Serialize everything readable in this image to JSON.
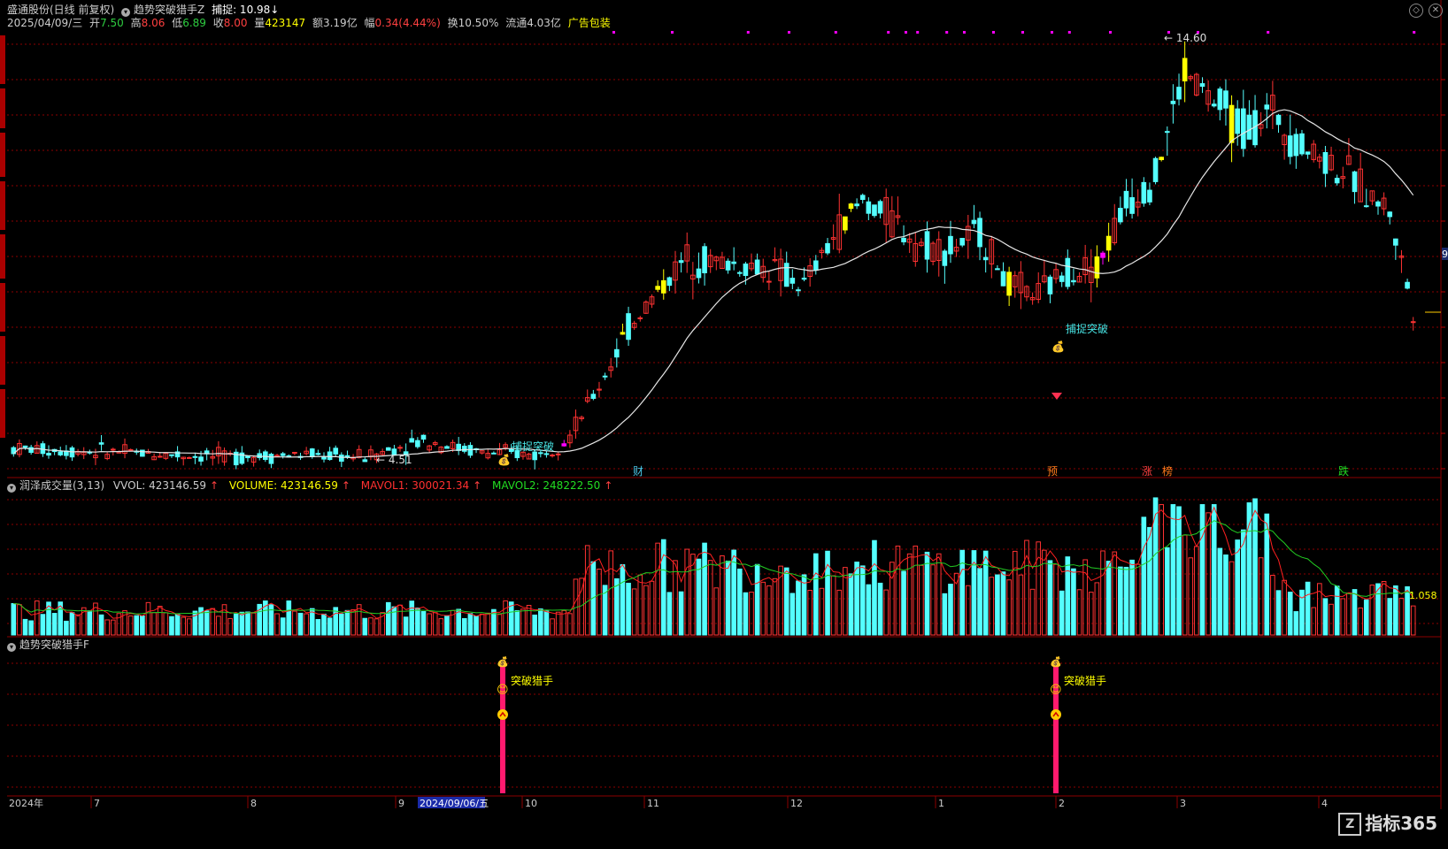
{
  "header": {
    "stock": "盛通股份(日线 前复权)",
    "indicator": "趋势突破猎手Z",
    "capture_label": "捕捉: 10.98",
    "capture_arrow": "↓",
    "date": "2025/04/09/三",
    "open_label": "开",
    "open": "7.50",
    "high_label": "高",
    "high": "8.06",
    "low_label": "低",
    "low": "6.89",
    "close_label": "收",
    "close": "8.00",
    "vol_label": "量",
    "vol": "423147",
    "amt_label": "额",
    "amt": "3.19亿",
    "chg_label": "幅",
    "chg": "0.34(4.44%)",
    "turn_label": "换",
    "turn": "10.50%",
    "float_label": "流通",
    "float": "4.03亿",
    "ad": "广告包装"
  },
  "price_labels": {
    "high": "14.60",
    "low": "4.51",
    "right_edge": "9"
  },
  "signals": {
    "breakout_1": "捕捉突破",
    "breakout_2": "捕捉突破"
  },
  "event_marks": [
    {
      "text": "财",
      "color": "#49c6e6"
    },
    {
      "text": "预",
      "color": "#ff7a1a"
    },
    {
      "text": "涨",
      "color": "#ff4040"
    },
    {
      "text": "榜",
      "color": "#ff7a1a"
    },
    {
      "text": "跌",
      "color": "#22dd22"
    }
  ],
  "volume_header": {
    "name": "润泽成交量(3,13)",
    "vvol": "VVOL: 423146.59",
    "volume": "VOLUME: 423146.59",
    "mavol1": "MAVOL1: 300021.34",
    "mavol2": "MAVOL2: 248222.50",
    "arrow": "↑",
    "right_value": "1.058"
  },
  "indicator_panel": {
    "name": "趋势突破猎手F",
    "label_1": "突破猎手",
    "label_2": "突破猎手"
  },
  "x_axis": {
    "year_label": "2024年",
    "months": [
      "7",
      "8",
      "9",
      "10",
      "11",
      "12",
      "1",
      "2",
      "3",
      "4"
    ],
    "cursor_date": "2024/09/06/五"
  },
  "watermark": {
    "logo": "Z",
    "text": "指标365"
  },
  "colors": {
    "up": "#ff3232",
    "down": "#54ffff",
    "yellow": "#ffff00",
    "magenta": "#ff00ff",
    "ma": "#e6e6e6",
    "mavol1": "#ff2020",
    "mavol2": "#22cc22",
    "grid": "#8b0000",
    "signal_bar": "#ff1a6e"
  },
  "chart_data": {
    "type": "candlestick",
    "price_range": [
      4.0,
      15.5
    ],
    "grid": true,
    "note_points": {
      "high": 14.6,
      "low": 4.51
    }
  }
}
